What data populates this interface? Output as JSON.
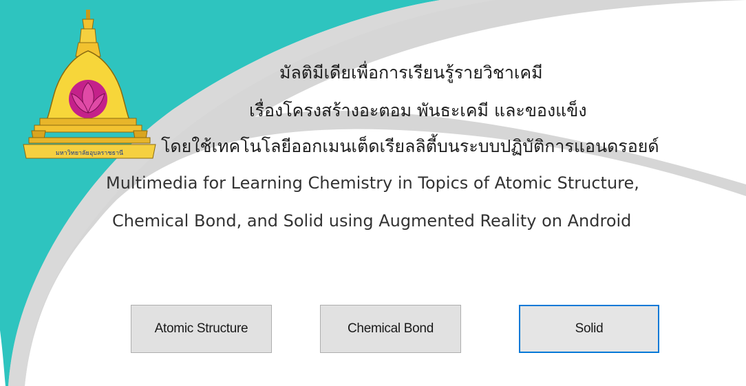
{
  "window": {
    "title_th_line1": "มัลติมีเดียเพื่อการเรียนรู้รายวิชาเคมี",
    "title_th_line2": "เรื่องโครงสร้างอะตอม พันธะเคมี และของแข็ง",
    "title_th_line3": "โดยใช้เทคโนโลยีออกเมนเต็ดเรียลลิตี้บนระบบปฏิบัติการแอนดรอยด์",
    "title_en_line1": "Multimedia for Learning Chemistry in Topics of Atomic Structure,",
    "title_en_line2": "Chemical Bond, and Solid using Augmented Reality on Android"
  },
  "logo": {
    "caption": "มหาวิทยาลัยอุบลราชธานี",
    "icon": "university-emblem-icon"
  },
  "buttons": {
    "atomic_label": "Atomic Structure",
    "bond_label": "Chemical Bond",
    "solid_label": "Solid"
  },
  "colors": {
    "teal": "#2ec4bf",
    "gray_swoosh": "#d4d4d4",
    "button_bg": "#e1e1e1",
    "focus_border": "#0078d7"
  }
}
